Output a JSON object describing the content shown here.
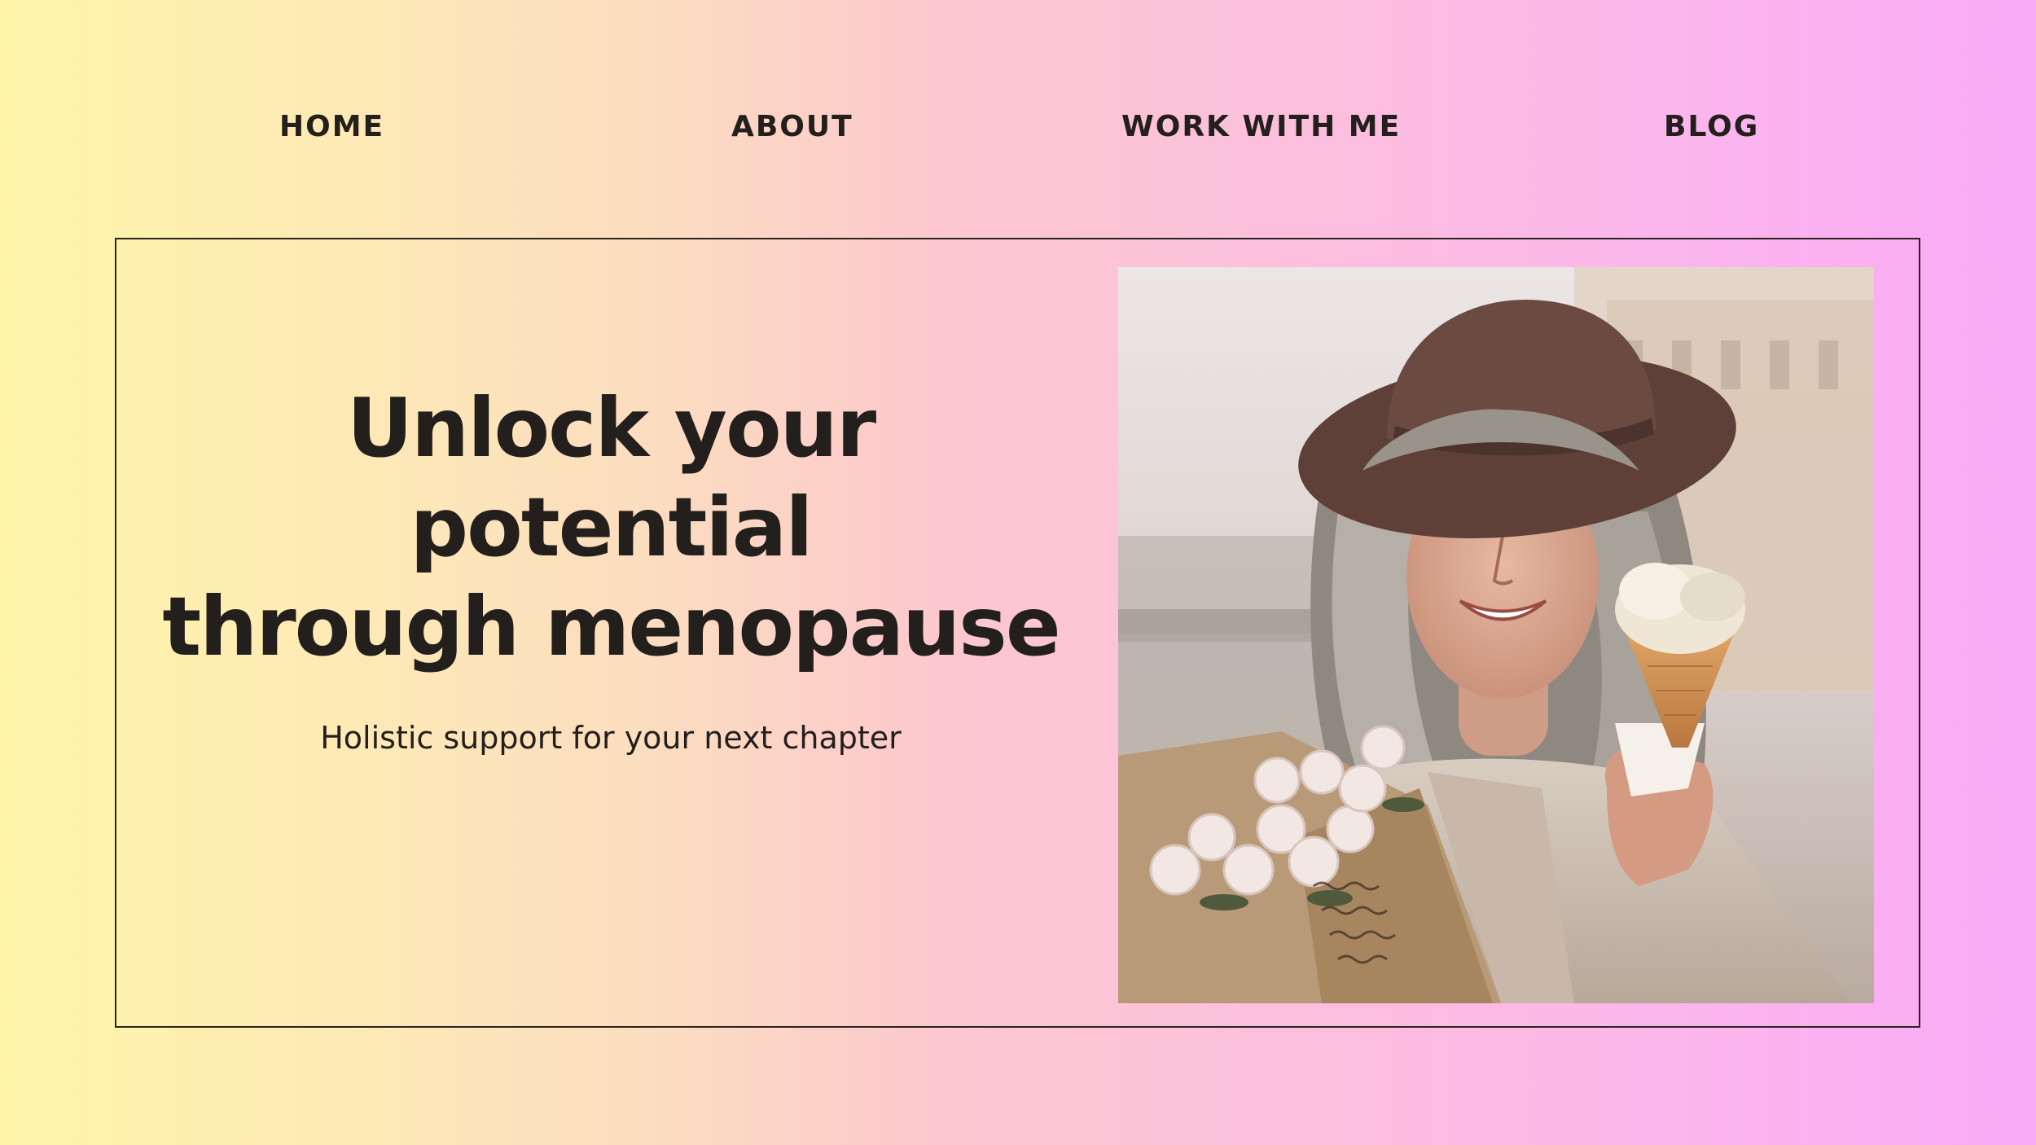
{
  "nav": {
    "home": "HOME",
    "about": "ABOUT",
    "work_with_me": "WORK WITH ME",
    "blog": "BLOG"
  },
  "hero": {
    "title_line1": "Unlock your potential",
    "title_line2": "through menopause",
    "subtitle": "Holistic support for your next chapter"
  }
}
